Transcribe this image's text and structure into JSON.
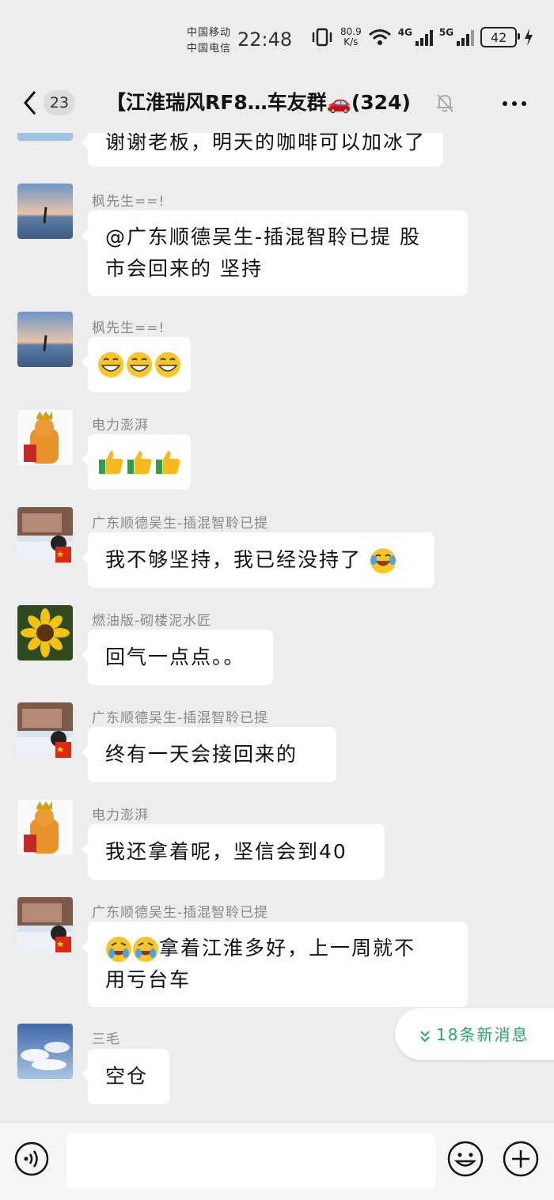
{
  "status": {
    "carrier1": "中国移动",
    "carrier2": "中国电信",
    "time": "22:48",
    "speed_value": "80.9",
    "speed_unit": "K/s",
    "net1": "4G",
    "net2": "5G",
    "battery": "42"
  },
  "header": {
    "unread_count": "23",
    "title": "【江淮瑞风RF8…车友群🚗(324)",
    "icons": [
      "back-arrow-icon",
      "bell-muted-icon",
      "more-icon"
    ]
  },
  "messages": [
    {
      "sender": "",
      "text": "谢谢老板，明天的咖啡可以加冰了"
    },
    {
      "sender": "枫先生==!",
      "line1": "@广东顺德吴生-插混智聆已提 股",
      "line2": "市会回来的 坚持"
    },
    {
      "sender": "枫先生==!",
      "emoji": "grin-x3"
    },
    {
      "sender": "电力澎湃",
      "emoji": "thumbs-up-x3"
    },
    {
      "sender": "广东顺德吴生-插混智聆已提",
      "text": "我不够坚持，我已经没持了"
    },
    {
      "sender": "燃油版-砌楼泥水匠",
      "text": "回气一点点。。"
    },
    {
      "sender": "广东顺德吴生-插混智聆已提",
      "text": "终有一天会接回来的"
    },
    {
      "sender": "电力澎湃",
      "text": "我还拿着呢，坚信会到40"
    },
    {
      "sender": "广东顺德吴生-插混智聆已提",
      "line1": "拿着江淮多好，上一周就不",
      "line2": "用亏台车"
    },
    {
      "sender": "三毛",
      "text": "空仓"
    }
  ],
  "new_messages": "18条新消息",
  "input": {
    "placeholder": ""
  },
  "colors": {
    "background": "#ededed",
    "bubble": "#ffffff",
    "accent_green": "#2aa66a"
  }
}
